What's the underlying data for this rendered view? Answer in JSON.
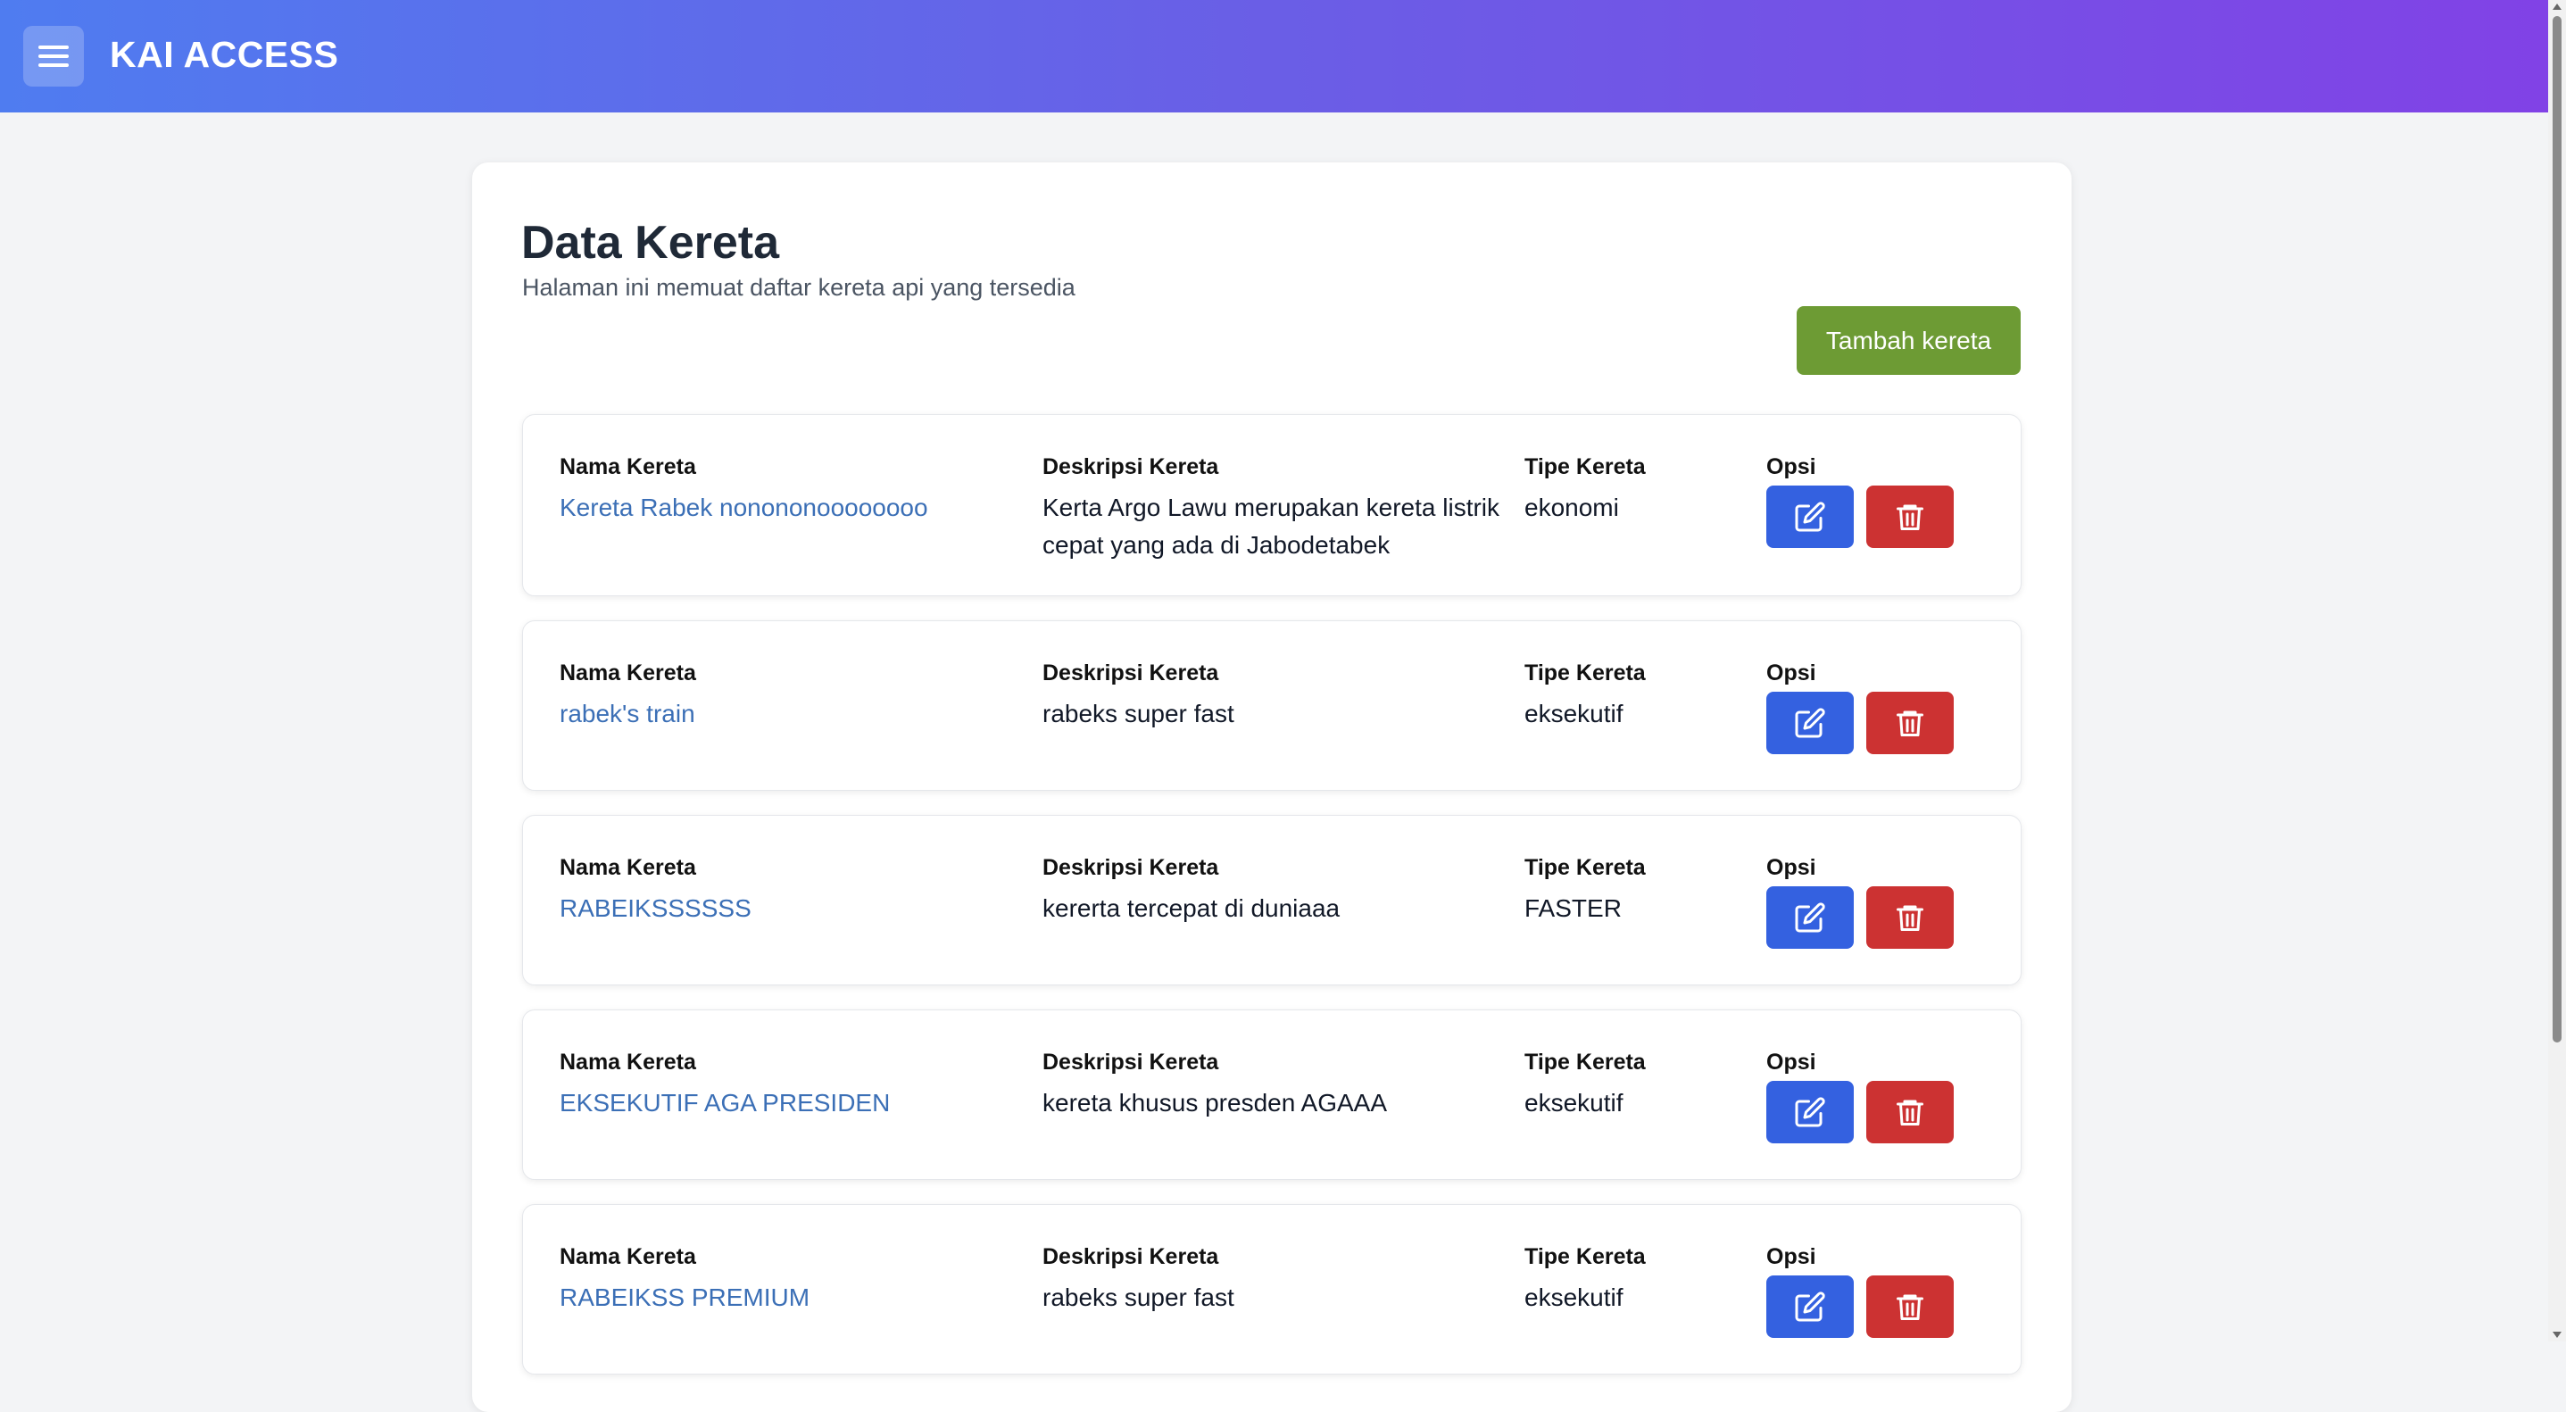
{
  "app": {
    "title": "KAI ACCESS"
  },
  "page": {
    "title": "Data Kereta",
    "subtitle": "Halaman ini memuat daftar kereta api yang tersedia",
    "add_button": "Tambah kereta"
  },
  "labels": {
    "name": "Nama Kereta",
    "description": "Deskripsi Kereta",
    "type": "Tipe Kereta",
    "options": "Opsi"
  },
  "trains": [
    {
      "name": "Kereta Rabek nonononoooooooo",
      "description": "Kerta Argo Lawu merupakan kereta listrik cepat yang ada di Jabodetabek",
      "type": "ekonomi"
    },
    {
      "name": "rabek's train",
      "description": "rabeks super fast",
      "type": "eksekutif"
    },
    {
      "name": "RABEIKSSSSSS",
      "description": "kererta tercepat di duniaaa",
      "type": "FASTER"
    },
    {
      "name": "EKSEKUTIF AGA PRESIDEN",
      "description": "kereta khusus presden AGAAA",
      "type": "eksekutif"
    },
    {
      "name": "RABEIKSS PREMIUM",
      "description": "rabeks super fast",
      "type": "eksekutif"
    }
  ],
  "icons": {
    "menu": "hamburger-menu-icon",
    "edit": "pencil-square-icon",
    "delete": "trash-icon"
  },
  "colors": {
    "header_gradient_start": "#4f7cf0",
    "header_gradient_end": "#8142e6",
    "add_button": "#6d9b34",
    "edit_button": "#3461e0",
    "delete_button": "#cc3232",
    "train_name": "#3b6fb6"
  }
}
